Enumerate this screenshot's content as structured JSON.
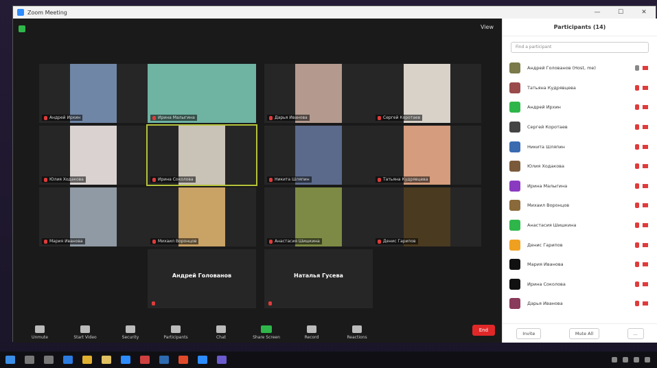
{
  "window": {
    "title": "Zoom Meeting",
    "controls": [
      "—",
      "☐",
      "✕"
    ]
  },
  "video": {
    "view_label": "View",
    "tiles": [
      {
        "name": "Андрей Ирхин",
        "bg": "#6f86a6"
      },
      {
        "name": "Ирина Малыгина",
        "bg": "#6fb3a3"
      },
      {
        "name": "Дарья Иванова",
        "bg": "#b49a8e"
      },
      {
        "name": "Сергей Коротаев",
        "bg": "#d8d2c9"
      },
      {
        "name": "Юлия Ходакова",
        "bg": "#d9d2d0"
      },
      {
        "name": "Ирина Соколова",
        "bg": "#c9c2b6"
      },
      {
        "name": "Никита Шляпин",
        "bg": "#5b6a8a"
      },
      {
        "name": "Татьяна Кудрявцева",
        "bg": "#d59c7d"
      },
      {
        "name": "Мария Иванова",
        "bg": "#8f9aa5"
      },
      {
        "name": "Михаил Воронцов",
        "bg": "#c9a266"
      },
      {
        "name": "Анастасия Шишкина",
        "bg": "#7d8a45"
      },
      {
        "name": "Денис Гарипов",
        "bg": "#4a3a20"
      }
    ],
    "name_tiles": [
      "Андрей Голованов",
      "Наталья Гусева"
    ]
  },
  "toolbar": {
    "buttons": [
      "Unmute",
      "Start Video",
      "Security",
      "Participants",
      "Chat",
      "Share Screen",
      "Record",
      "Reactions"
    ],
    "end_label": "End"
  },
  "panel": {
    "title": "Participants (14)",
    "search_placeholder": "Find a participant",
    "participants": [
      {
        "name": "Андрей Голованов (Host, me)",
        "color": "#7a7a4a"
      },
      {
        "name": "Татьяна Кудрявцева",
        "color": "#9a4a4a"
      },
      {
        "name": "Андрей Ирхин",
        "color": "#2fb64a"
      },
      {
        "name": "Сергей Коротаев",
        "color": "#444"
      },
      {
        "name": "Никита Шляпин",
        "color": "#3a6ab0"
      },
      {
        "name": "Юлия Ходакова",
        "color": "#7a5a3a"
      },
      {
        "name": "Ирина Малыгина",
        "color": "#8a3ac0"
      },
      {
        "name": "Михаил Воронцов",
        "color": "#8a6a3a"
      },
      {
        "name": "Анастасия Шишкина",
        "color": "#2fb64a"
      },
      {
        "name": "Денис Гарипов",
        "color": "#f0a020"
      },
      {
        "name": "Мария Иванова",
        "color": "#111"
      },
      {
        "name": "Ирина Соколова",
        "color": "#111"
      },
      {
        "name": "Дарья Иванова",
        "color": "#8a3a5a"
      }
    ],
    "footer": [
      "Invite",
      "Mute All",
      "..."
    ]
  }
}
